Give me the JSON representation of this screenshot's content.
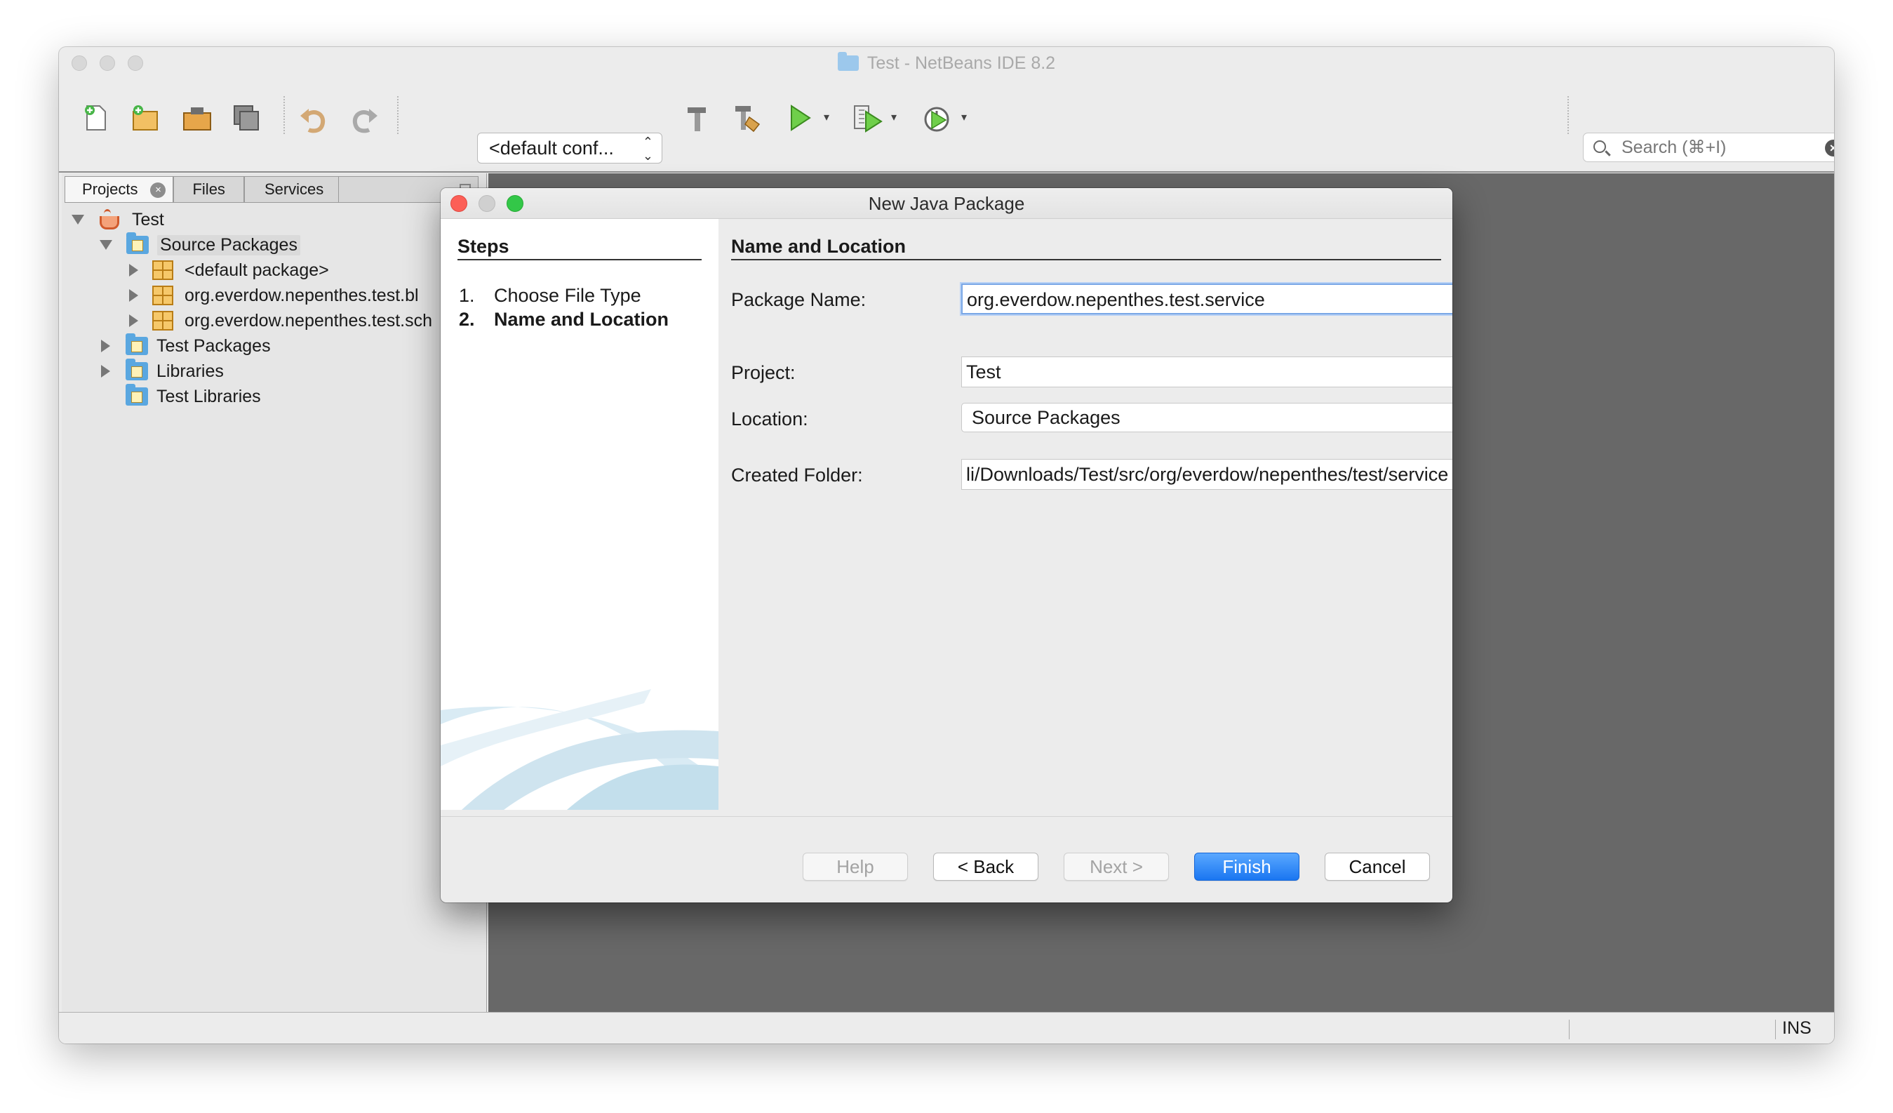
{
  "window": {
    "title": "Test - NetBeans IDE 8.2"
  },
  "toolbar": {
    "config_combo": "<default conf...",
    "search_placeholder": "Search (⌘+I)",
    "icons": [
      "new-file-icon",
      "new-project-icon",
      "open-project-icon",
      "save-all-icon",
      "undo-icon",
      "redo-icon",
      "build-hammer-icon",
      "clean-build-icon",
      "run-icon",
      "debug-icon",
      "profile-icon"
    ]
  },
  "left_panel": {
    "tabs": [
      "Projects",
      "Files",
      "Services"
    ],
    "tree": [
      {
        "label": "Test",
        "icon": "coffee-cup-icon",
        "level": 0,
        "expanded": true
      },
      {
        "label": "Source Packages",
        "icon": "source-folder-icon",
        "level": 1,
        "expanded": true,
        "selected": true
      },
      {
        "label": "<default package>",
        "icon": "package-icon",
        "level": 2
      },
      {
        "label": "org.everdow.nepenthes.test.bl",
        "icon": "package-icon",
        "level": 2
      },
      {
        "label": "org.everdow.nepenthes.test.sch",
        "icon": "package-icon",
        "level": 2
      },
      {
        "label": "Test Packages",
        "icon": "source-folder-icon",
        "level": 1
      },
      {
        "label": "Libraries",
        "icon": "library-icon",
        "level": 1
      },
      {
        "label": "Test Libraries",
        "icon": "library-icon",
        "level": 1
      }
    ]
  },
  "dialog": {
    "title": "New Java Package",
    "steps_heading": "Steps",
    "steps": [
      {
        "num": "1.",
        "label": "Choose File Type"
      },
      {
        "num": "2.",
        "label": "Name and Location"
      }
    ],
    "section_heading": "Name and Location",
    "package_name_label": "Package Name:",
    "package_name_value": "org.everdow.nepenthes.test.service",
    "project_label": "Project:",
    "project_value": "Test",
    "location_label": "Location:",
    "location_value": "Source Packages",
    "created_folder_label": "Created Folder:",
    "created_folder_value": "li/Downloads/Test/src/org/everdow/nepenthes/test/service",
    "buttons": {
      "help": "Help",
      "back": "< Back",
      "next": "Next >",
      "finish": "Finish",
      "cancel": "Cancel"
    }
  },
  "statusbar": {
    "mode": "INS"
  },
  "colors": {
    "accent": "#1a76f1",
    "editor_bg": "#686868",
    "close_red": "#fc5f57",
    "zoom_green": "#33c748"
  }
}
